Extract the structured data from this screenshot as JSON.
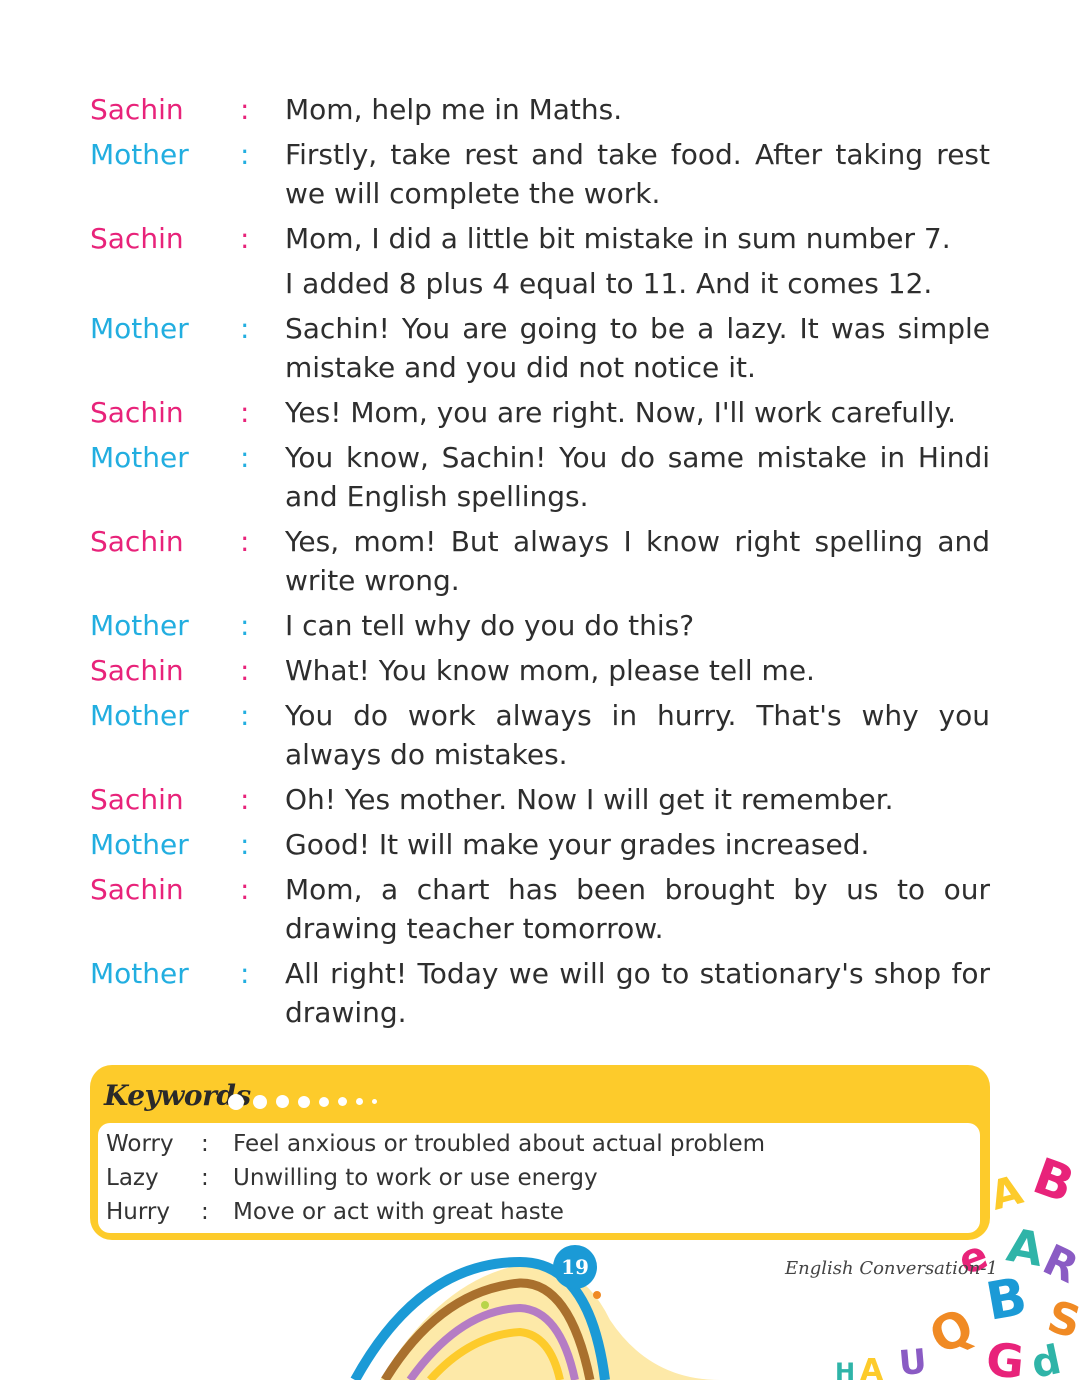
{
  "dialogue": [
    {
      "speaker": "Sachin",
      "text": "Mom, help me in Maths."
    },
    {
      "speaker": "Mother",
      "text": "Firstly, take rest and take food. After taking rest we will complete the work."
    },
    {
      "speaker": "Sachin",
      "text": "Mom, I did a little bit mistake in sum number 7."
    },
    {
      "speaker": "",
      "text": "I added 8 plus 4 equal to 11. And it comes 12."
    },
    {
      "speaker": "Mother",
      "text": "Sachin! You are going to be a lazy. It was simple mistake and you did not notice it."
    },
    {
      "speaker": "Sachin",
      "text": "Yes! Mom, you are right. Now, I'll work carefully."
    },
    {
      "speaker": "Mother",
      "text": "You know, Sachin! You do same mistake in Hindi and English spellings."
    },
    {
      "speaker": "Sachin",
      "text": "Yes, mom! But always I know right spelling and write wrong."
    },
    {
      "speaker": "Mother",
      "text": "I can tell why do you do this?"
    },
    {
      "speaker": "Sachin",
      "text": "What! You know mom, please tell me."
    },
    {
      "speaker": "Mother",
      "text": "You do work always in hurry. That's why you always do mistakes."
    },
    {
      "speaker": "Sachin",
      "text": "Oh! Yes mother. Now I will get it remember."
    },
    {
      "speaker": "Mother",
      "text": "Good! It will make your grades increased."
    },
    {
      "speaker": "Sachin",
      "text": "Mom, a chart has been brought by us to our drawing teacher tomorrow."
    },
    {
      "speaker": "Mother",
      "text": "All right! Today we will go to stationary's shop for drawing."
    }
  ],
  "keywords": {
    "title": "Keywords",
    "items": [
      {
        "word": "Worry",
        "meaning": "Feel anxious or troubled about actual problem"
      },
      {
        "word": "Lazy",
        "meaning": "Unwilling to work or use energy"
      },
      {
        "word": "Hurry",
        "meaning": "Move or act with great haste"
      }
    ]
  },
  "footer": {
    "page_number": "19",
    "book_title": "English Conversation-1"
  },
  "colors": {
    "sachin": "#e8237a",
    "mother": "#22aee0",
    "keyword_box": "#fdcb2b",
    "page_badge": "#1b9ad6"
  }
}
